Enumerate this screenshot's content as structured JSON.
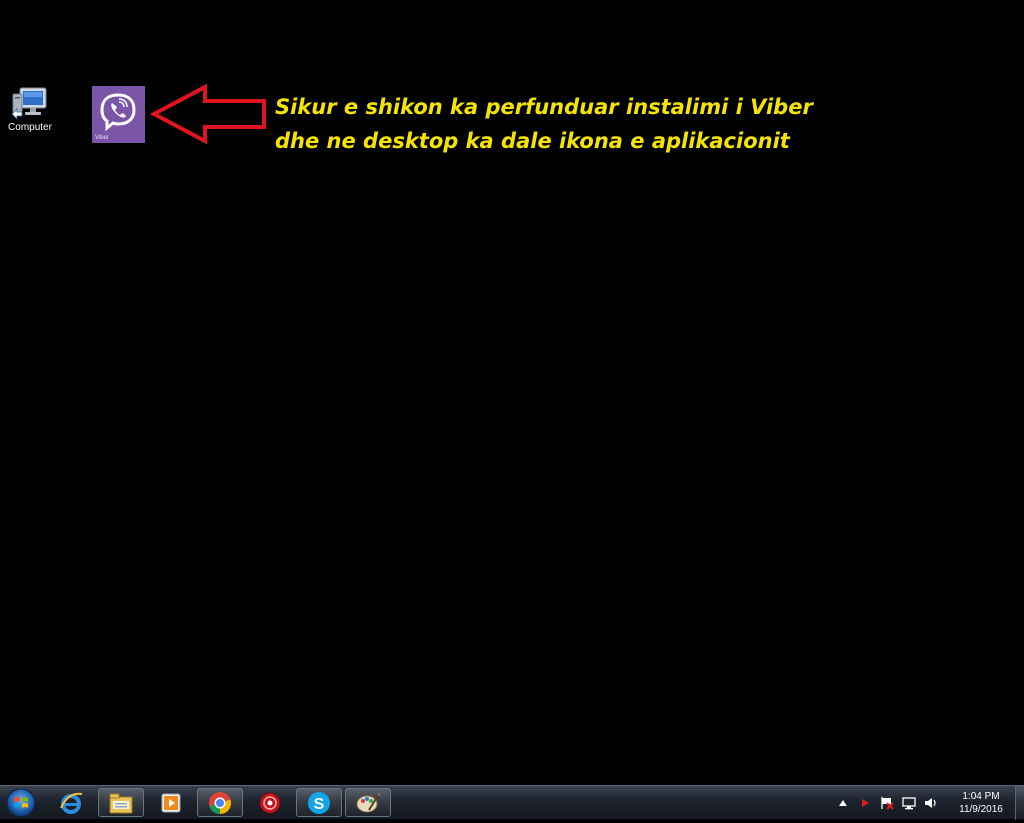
{
  "desktop": {
    "icons": [
      {
        "label": "Computer",
        "icon": "computer-icon"
      },
      {
        "label": "Viber",
        "icon": "viber-icon"
      }
    ],
    "annotation": {
      "line1": "Sikur e shikon ka perfunduar instalimi i Viber",
      "line2": "dhe ne desktop ka dale ikona e aplikacionit",
      "text_color": "#f5e400",
      "arrow_color": "#e0141e"
    }
  },
  "taskbar": {
    "start_icon": "windows-start-orb",
    "pinned": [
      {
        "name": "internet-explorer-icon"
      },
      {
        "name": "windows-explorer-icon"
      },
      {
        "name": "media-player-icon"
      },
      {
        "name": "chrome-icon"
      },
      {
        "name": "recorder-icon"
      },
      {
        "name": "skype-icon"
      },
      {
        "name": "paint-icon"
      }
    ],
    "tray": {
      "icons": [
        "show-hidden-icons-icon",
        "flag-icon",
        "action-center-icon",
        "network-icon",
        "volume-icon"
      ],
      "time": "1:04 PM",
      "date": "11/9/2016"
    }
  },
  "colors": {
    "desktop_bg": "#000000",
    "viber_purple": "#7b55a8"
  }
}
